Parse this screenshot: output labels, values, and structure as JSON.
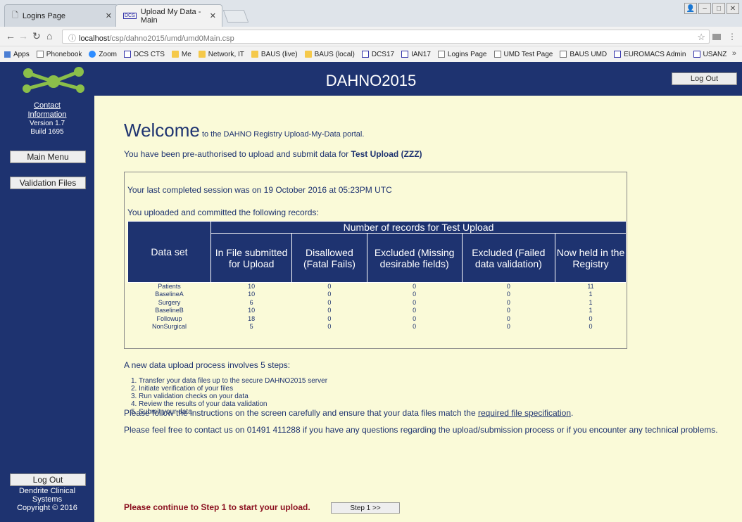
{
  "browser": {
    "tabs": [
      {
        "label": "Logins Page"
      },
      {
        "label": "Upload My Data - Main"
      }
    ],
    "url_host": "localhost",
    "url_path": "/csp/dahno2015/umd/umd0Main.csp",
    "bookmarks": [
      {
        "label": "Apps",
        "icon": "apps-icon"
      },
      {
        "label": "Phonebook",
        "icon": "page-icon"
      },
      {
        "label": "Zoom",
        "icon": "zoom-icon"
      },
      {
        "label": "DCS CTS",
        "icon": "dcs-icon"
      },
      {
        "label": "Me",
        "icon": "folder-icon"
      },
      {
        "label": "Network, IT",
        "icon": "folder-icon"
      },
      {
        "label": "BAUS (live)",
        "icon": "folder-icon"
      },
      {
        "label": "BAUS (local)",
        "icon": "folder-icon"
      },
      {
        "label": "DCS17",
        "icon": "dcs-icon"
      },
      {
        "label": "IAN17",
        "icon": "dcs-icon"
      },
      {
        "label": "Logins Page",
        "icon": "page-icon"
      },
      {
        "label": "UMD Test Page",
        "icon": "page-icon"
      },
      {
        "label": "BAUS UMD",
        "icon": "page-icon"
      },
      {
        "label": "EUROMACS Admin",
        "icon": "dcs-icon"
      },
      {
        "label": "USANZ",
        "icon": "dcs-icon"
      }
    ],
    "more": "»"
  },
  "header": {
    "title": "DAHNO2015",
    "logout": "Log Out"
  },
  "sidebar": {
    "contact_line1": "Contact",
    "contact_line2": "Information",
    "version": "Version 1.7",
    "build": "Build 1695",
    "main_menu": "Main Menu",
    "validation_files": "Validation Files",
    "logout": "Log Out",
    "footer_line1": "Dendrite Clinical",
    "footer_line2": "Systems",
    "footer_line3": "Copyright © 2016"
  },
  "main": {
    "welcome_big": "Welcome",
    "welcome_rest": " to the DAHNO Registry Upload-My-Data portal.",
    "preauth_prefix": "You have been pre-authorised to upload and submit data for ",
    "preauth_org": "Test Upload (ZZZ)",
    "last_session": "Your last completed session was on 19 October 2016 at 05:23PM UTC",
    "uploaded_intro": "You uploaded and committed the following records:",
    "table": {
      "group_header": "Number of records for Test Upload",
      "dataset_header": "Data set",
      "col_headers": [
        "In File submitted for Upload",
        "Disallowed (Fatal Fails)",
        "Excluded (Missing desirable fields)",
        "Excluded (Failed data validation)",
        "Now held in the Registry"
      ],
      "rows": [
        {
          "name": "Patients",
          "vals": [
            "10",
            "0",
            "0",
            "0",
            "11"
          ]
        },
        {
          "name": "BaselineA",
          "vals": [
            "10",
            "0",
            "0",
            "0",
            "1"
          ]
        },
        {
          "name": "Surgery",
          "vals": [
            "6",
            "0",
            "0",
            "0",
            "1"
          ]
        },
        {
          "name": "BaselineB",
          "vals": [
            "10",
            "0",
            "0",
            "0",
            "1"
          ]
        },
        {
          "name": "Followup",
          "vals": [
            "18",
            "0",
            "0",
            "0",
            "0"
          ]
        },
        {
          "name": "NonSurgical",
          "vals": [
            "5",
            "0",
            "0",
            "0",
            "0"
          ]
        }
      ]
    },
    "steps_intro": "A new data upload process involves 5 steps:",
    "steps": [
      "1. Transfer your data files up to the secure DAHNO2015 server",
      "2. Initiate verification of your files",
      "3. Run validation checks on your data",
      "4. Review the results of your data validation",
      "5. Submit your data"
    ],
    "follow_prefix": "Please follow the instructions on the screen carefully and ensure that your data files match the ",
    "follow_link": "required file specification",
    "follow_suffix": ".",
    "contact_line": "Please feel free to contact us on 01491 411288 if you have any questions regarding the upload/submission process or if you encounter any technical problems.",
    "continue_text": "Please continue to Step 1 to start your upload.",
    "step1_button": "Step 1 >>"
  },
  "colors": {
    "navy": "#1e3370",
    "cream": "#fafad8",
    "continue_red": "#8b1020"
  }
}
